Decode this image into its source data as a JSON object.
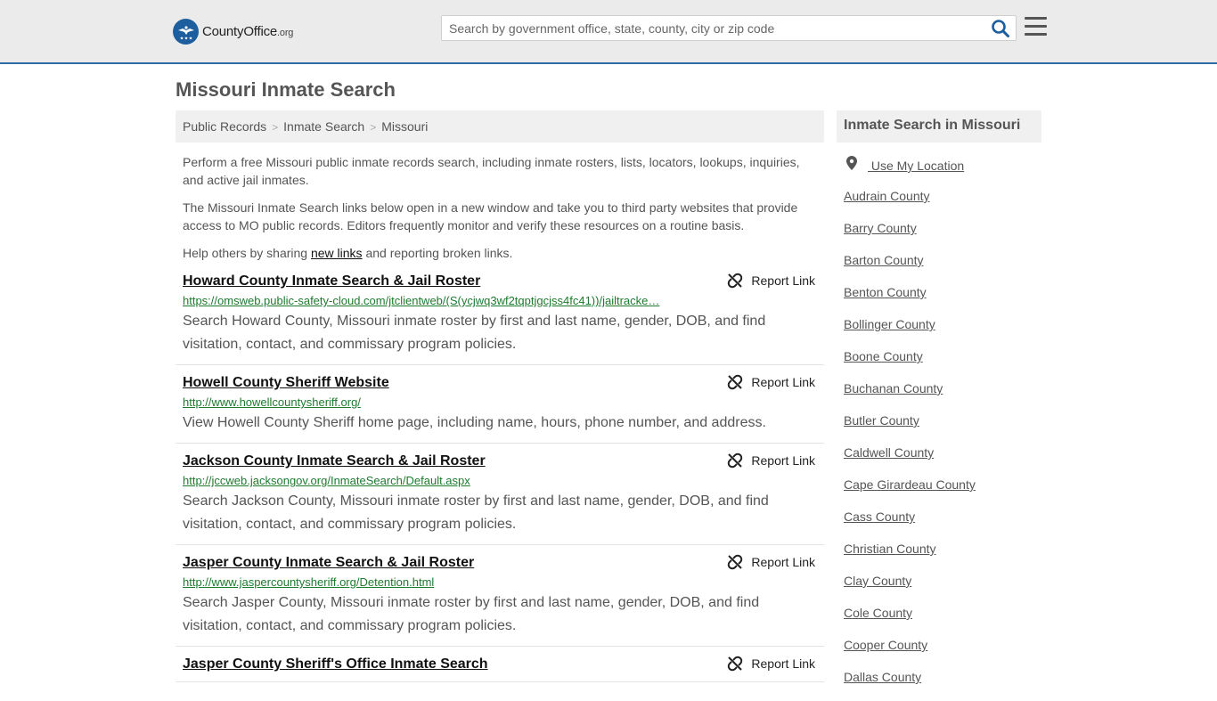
{
  "header": {
    "logo_name": "CountyOffice",
    "logo_tld": ".org",
    "search_placeholder": "Search by government office, state, county, city or zip code"
  },
  "page_title": "Missouri Inmate Search",
  "breadcrumb": [
    {
      "label": "Public Records"
    },
    {
      "label": "Inmate Search"
    },
    {
      "label": "Missouri"
    }
  ],
  "intro": {
    "p1": "Perform a free Missouri public inmate records search, including inmate rosters, lists, locators, lookups, inquiries, and active jail inmates.",
    "p2": "The Missouri Inmate Search links below open in a new window and take you to third party websites that provide access to MO public records. Editors frequently monitor and verify these resources on a routine basis.",
    "p3_before": "Help others by sharing ",
    "p3_link": "new links",
    "p3_after": " and reporting broken links."
  },
  "report_label": "Report Link",
  "results": [
    {
      "title": "Howard County Inmate Search & Jail Roster",
      "url": "https://omsweb.public-safety-cloud.com/jtclientweb/(S(ycjwq3wf2tqptjgcjss4fc41))/jailtracke…",
      "desc": "Search Howard County, Missouri inmate roster by first and last name, gender, DOB, and find visitation, contact, and commissary program policies."
    },
    {
      "title": "Howell County Sheriff Website",
      "url": "http://www.howellcountysheriff.org/",
      "desc": "View Howell County Sheriff home page, including name, hours, phone number, and address."
    },
    {
      "title": "Jackson County Inmate Search & Jail Roster",
      "url": "http://jccweb.jacksongov.org/InmateSearch/Default.aspx",
      "desc": "Search Jackson County, Missouri inmate roster by first and last name, gender, DOB, and find visitation, contact, and commissary program policies."
    },
    {
      "title": "Jasper County Inmate Search & Jail Roster",
      "url": "http://www.jaspercountysheriff.org/Detention.html",
      "desc": "Search Jasper County, Missouri inmate roster by first and last name, gender, DOB, and find visitation, contact, and commissary program policies."
    },
    {
      "title": "Jasper County Sheriff's Office Inmate Search",
      "url": "",
      "desc": ""
    }
  ],
  "sidebar": {
    "heading": "Inmate Search in Missouri",
    "use_location": "Use My Location",
    "counties": [
      "Audrain County",
      "Barry County",
      "Barton County",
      "Benton County",
      "Bollinger County",
      "Boone County",
      "Buchanan County",
      "Butler County",
      "Caldwell County",
      "Cape Girardeau County",
      "Cass County",
      "Christian County",
      "Clay County",
      "Cole County",
      "Cooper County",
      "Dallas County"
    ]
  },
  "colors": {
    "accent_blue": "#2e6ca4",
    "url_green": "#1e7a2f",
    "header_bg": "#ebebeb"
  }
}
